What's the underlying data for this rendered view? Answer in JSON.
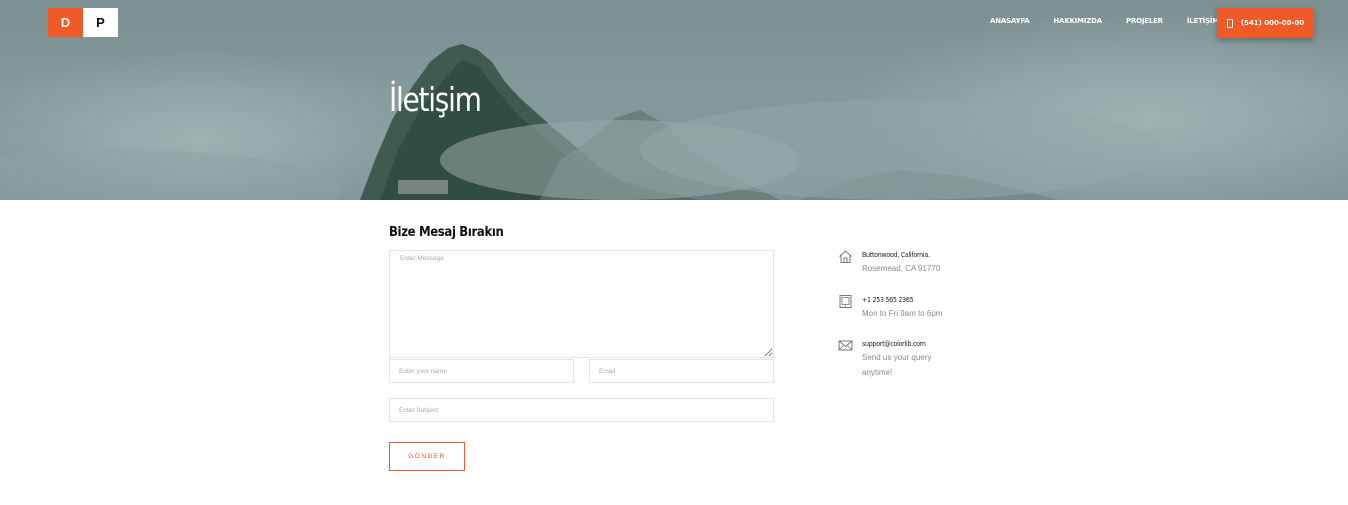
{
  "logo": {
    "left": "D",
    "right": "P"
  },
  "nav": {
    "items": [
      "ANASAYFA",
      "HAKKIMIZDA",
      "PROJELER",
      "İLETİŞİM"
    ]
  },
  "phone_button": {
    "label": "(541) 000-00-00",
    "icon": "phone-icon"
  },
  "hero": {
    "title": "İletişim"
  },
  "form": {
    "title": "Bize Mesaj Bırakın",
    "message_placeholder": "Enter Message",
    "name_placeholder": "Enter your name",
    "email_placeholder": "Email",
    "subject_placeholder": "Enter Subject",
    "submit_label": "GÖNDER"
  },
  "contact": [
    {
      "icon": "home-icon",
      "line1": "Buttonwood, California.",
      "line2": "Rosemead, CA 91770"
    },
    {
      "icon": "tablet-icon",
      "line1": "+1 253 565 2365",
      "line2": "Mon to Fri 9am to 6pm"
    },
    {
      "icon": "mail-icon",
      "line1": "support@colorlib.com",
      "line2": "Send us your query anytime!"
    }
  ],
  "colors": {
    "accent": "#f05a28",
    "hero_overlay": "#7f9496",
    "text_dark": "#111111",
    "text_muted": "#8a8a8a"
  }
}
